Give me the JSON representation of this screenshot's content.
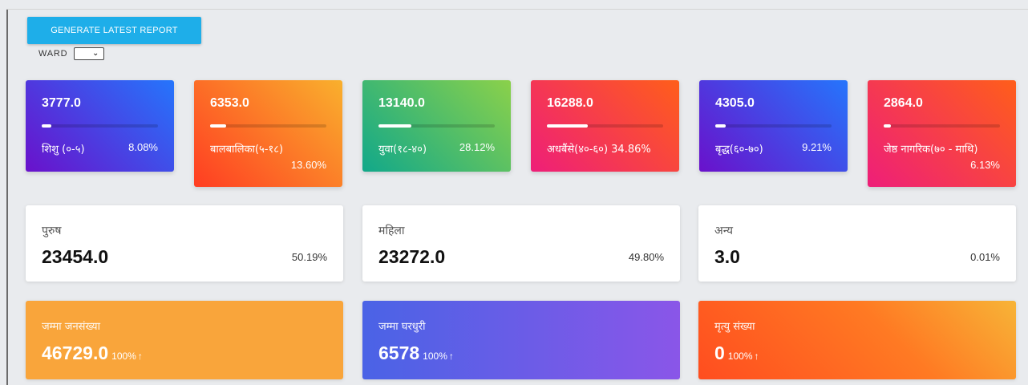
{
  "toolbar": {
    "generate_label": "GENERATE LATEST REPORT",
    "ward_label": "WARD",
    "ward_selected": ""
  },
  "age_groups": [
    {
      "value": "3777.0",
      "label": "शिशु (०-५)",
      "percent": "8.08%",
      "fill": 0.08
    },
    {
      "value": "6353.0",
      "label": "बालबालिका(५-१८)",
      "percent": "13.60%",
      "fill": 0.14
    },
    {
      "value": "13140.0",
      "label": "युवा(१८-४०)",
      "percent": "28.12%",
      "fill": 0.28
    },
    {
      "value": "16288.0",
      "label": "अधबैंसे(४०-६०)",
      "percent": "34.86%",
      "fill": 0.35
    },
    {
      "value": "4305.0",
      "label": "बृद्ध(६०-७०)",
      "percent": "9.21%",
      "fill": 0.09
    },
    {
      "value": "2864.0",
      "label": "जेष्ठ नागरिक(७० - माथि)",
      "percent": "6.13%",
      "fill": 0.06
    }
  ],
  "gender": [
    {
      "label": "पुरुष",
      "value": "23454.0",
      "percent": "50.19%"
    },
    {
      "label": "महिला",
      "value": "23272.0",
      "percent": "49.80%"
    },
    {
      "label": "अन्य",
      "value": "3.0",
      "percent": "0.01%"
    }
  ],
  "totals": [
    {
      "label": "जम्मा जनसंख्या",
      "value": "46729.0",
      "percent": "100%",
      "arrow": "↑"
    },
    {
      "label": "जम्मा घरधुरी",
      "value": "6578",
      "percent": "100%",
      "arrow": "↑"
    },
    {
      "label": "मृत्यु संख्या",
      "value": "0",
      "percent": "100%",
      "arrow": "↑"
    }
  ],
  "icons": {
    "ward_dropdown": "chevron-down-icon",
    "trend": "arrow-up-icon"
  }
}
